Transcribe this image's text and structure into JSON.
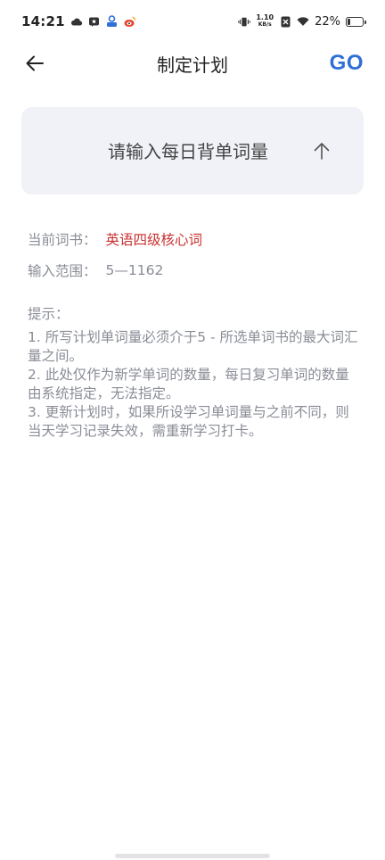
{
  "status_bar": {
    "time": "14:21",
    "net_speed_value": "1.10",
    "net_speed_unit": "KB/s",
    "battery_percent": "22%",
    "battery_level": 0.22
  },
  "header": {
    "title": "制定计划",
    "go_label": "GO"
  },
  "input": {
    "placeholder": "请输入每日背单词量",
    "value": ""
  },
  "info": {
    "book_label": "当前词书：",
    "book_name": "英语四级核心词",
    "range_label": "输入范围：",
    "range_value": "5—1162"
  },
  "tips": {
    "title": "提示：",
    "items": [
      "1. 所写计划单词量必须介于5 - 所选单词书的最大词汇量之间。",
      "2. 此处仅作为新学单词的数量，每日复习单词的数量由系统指定，无法指定。",
      "3. 更新计划时，如果所设学习单词量与之前不同，则当天学习记录失效，需重新学习打卡。"
    ]
  },
  "colors": {
    "accent": "#2f6fd6",
    "book_highlight": "#c8312f",
    "card_bg": "#f1f2f7"
  }
}
